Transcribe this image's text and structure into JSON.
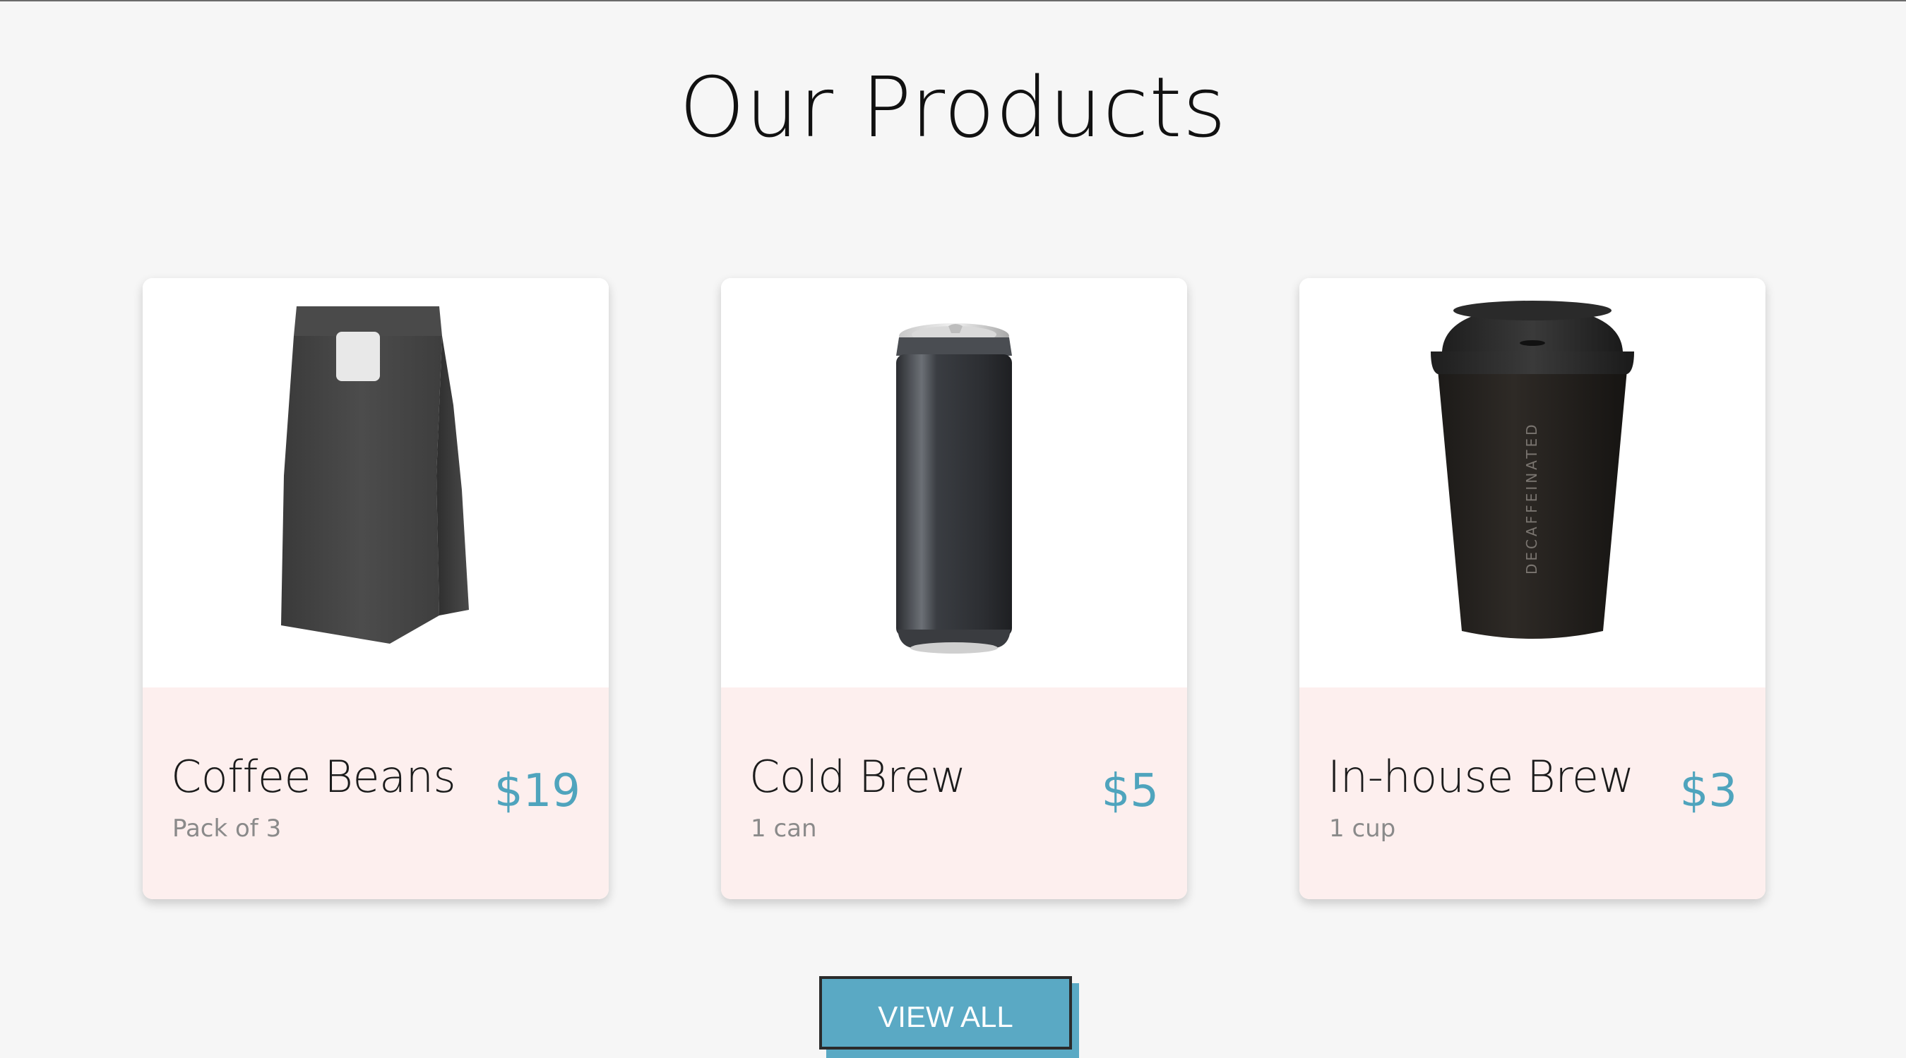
{
  "section": {
    "title": "Our Products"
  },
  "products": [
    {
      "name": "Coffee Beans",
      "subtitle": "Pack of 3",
      "price": "$19",
      "image": "coffee-bag-image"
    },
    {
      "name": "Cold Brew",
      "subtitle": "1 can",
      "price": "$5",
      "image": "coffee-can-image"
    },
    {
      "name": "In-house Brew",
      "subtitle": "1 cup",
      "price": "$3",
      "image": "coffee-cup-image"
    }
  ],
  "cup_label": "DECAFFEINATED",
  "view_all_label": "VIEW ALL",
  "colors": {
    "page_bg": "#f6f6f6",
    "card_footer_bg": "#fdefee",
    "price": "#4fa4bd",
    "button": "#5aa9c4"
  }
}
